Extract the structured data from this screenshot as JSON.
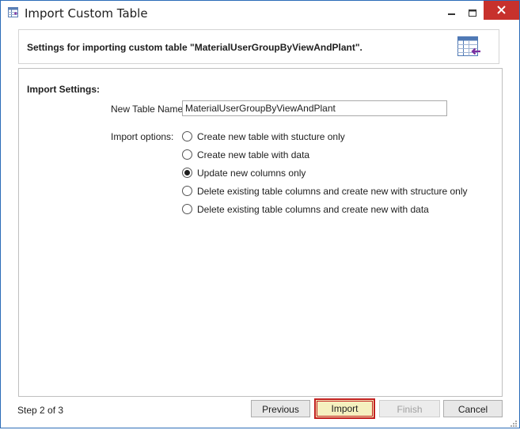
{
  "window": {
    "title": "Import Custom Table"
  },
  "header": {
    "text": "Settings for importing custom table \"MaterialUserGroupByViewAndPlant\".",
    "icon": "import-table-icon"
  },
  "import_settings": {
    "section_title": "Import Settings:",
    "table_name_label": "New Table Name:",
    "table_name_value": "MaterialUserGroupByViewAndPlant",
    "options_label": "Import options:",
    "options": [
      {
        "label": "Create new table with stucture only",
        "selected": false
      },
      {
        "label": "Create new table with data",
        "selected": false
      },
      {
        "label": "Update new columns only",
        "selected": true
      },
      {
        "label": "Delete existing table columns and create new with structure only",
        "selected": false
      },
      {
        "label": "Delete existing table columns and create new with data",
        "selected": false
      }
    ]
  },
  "footer": {
    "step_text": "Step 2 of 3",
    "previous_label": "Previous",
    "import_label": "Import",
    "finish_label": "Finish",
    "cancel_label": "Cancel"
  },
  "colors": {
    "accent_border": "#2b6cb8",
    "close_button": "#c7312c",
    "import_button_bg": "#f5f0bf",
    "import_button_border": "#c21f1f",
    "icon_purple": "#7b2fa0"
  }
}
